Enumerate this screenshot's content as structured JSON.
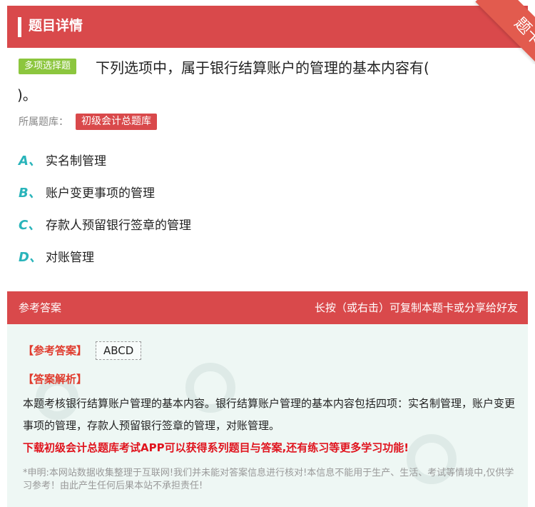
{
  "header": {
    "title": "题目详情",
    "ribbon": "题卡"
  },
  "question": {
    "type_tag": "多项选择题",
    "text_line1": "下列选项中，属于银行结算账户的管理的基本内容有(",
    "text_line2": ")。"
  },
  "source": {
    "label": "所属题库：",
    "bank": "初级会计总题库"
  },
  "options": [
    {
      "key": "A、",
      "text": "实名制管理"
    },
    {
      "key": "B、",
      "text": "账户变更事项的管理"
    },
    {
      "key": "C、",
      "text": "存款人预留银行签章的管理"
    },
    {
      "key": "D、",
      "text": "对账管理"
    }
  ],
  "answer_panel": {
    "title": "参考答案",
    "hint": "长按（或右击）可复制本题卡或分享给好友",
    "ref_label": "【参考答案】",
    "ref_value": "ABCD",
    "analysis_label": "【答案解析】",
    "analysis_text": "本题考核银行结算账户管理的基本内容。银行结算账户管理的基本内容包括四项：实名制管理，账户变更事项的管理，存款人预留银行签章的管理，对账管理。",
    "promo": "下载初级会计总题库考试APP可以获得系列题目与答案,还有练习等更多学习功能!",
    "disclaimer": "*申明:本网站数据收集整理于互联网!我们并未能对答案信息进行核对!本信息不能用于生产、生活、考试等情境中,仅供学习参考！由此产生任何后果本站不承担责任!"
  }
}
